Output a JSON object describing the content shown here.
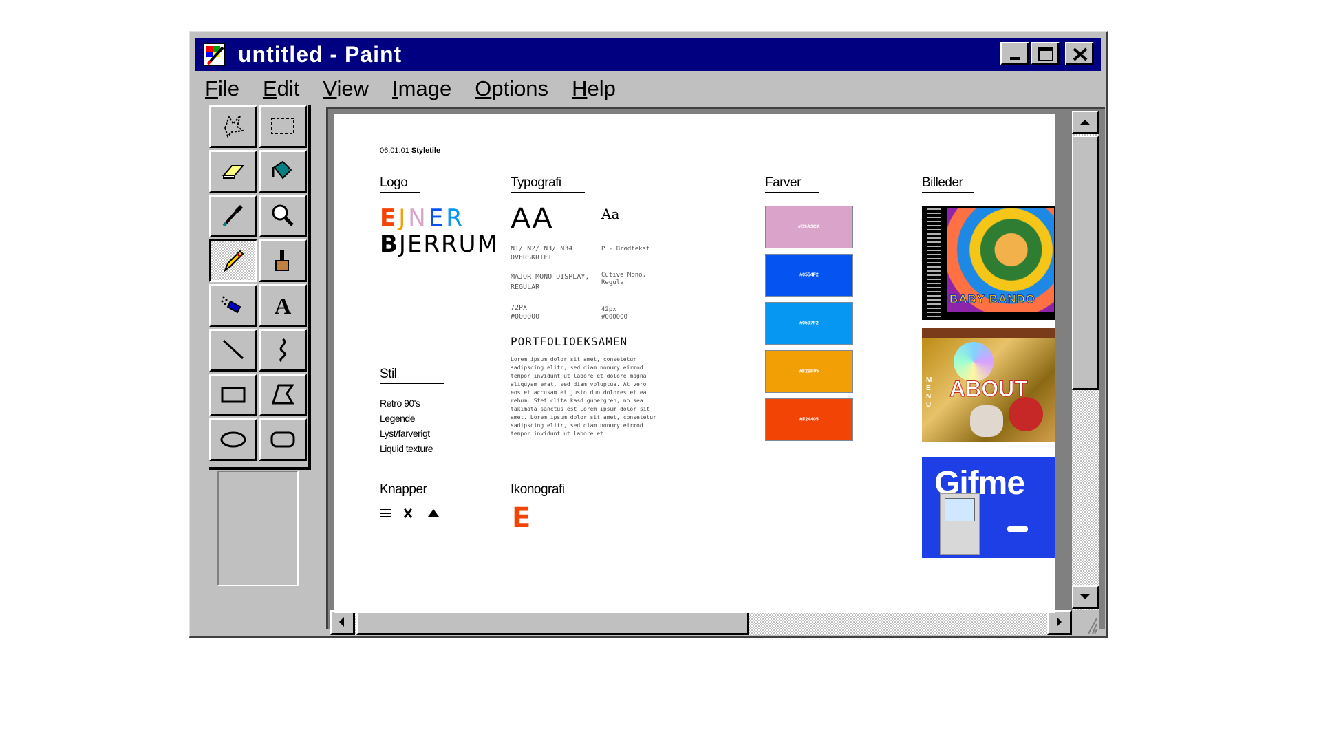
{
  "window": {
    "title": "untitled - Paint",
    "controls": {
      "minimize": "minimize",
      "maximize": "maximize",
      "close": "close"
    }
  },
  "menu": [
    {
      "key": "F",
      "rest": "ile"
    },
    {
      "key": "E",
      "rest": "dit"
    },
    {
      "key": "V",
      "rest": "iew"
    },
    {
      "key": "I",
      "rest": "mage"
    },
    {
      "key": "O",
      "rest": "ptions"
    },
    {
      "key": "H",
      "rest": "elp"
    }
  ],
  "tools": [
    "free-form-select-icon",
    "select-icon",
    "eraser-icon",
    "fill-bucket-icon",
    "color-picker-icon",
    "magnifier-icon",
    "pencil-icon",
    "brush-icon",
    "airbrush-icon",
    "text-icon",
    "line-icon",
    "curve-icon",
    "rectangle-icon",
    "polygon-icon",
    "ellipse-icon",
    "rounded-rectangle-icon"
  ],
  "active_tool": "pencil-icon",
  "doc": {
    "header_num": "06.01.01",
    "header_title": "Styletile",
    "logo": {
      "title": "Logo",
      "line1": [
        "E",
        "J",
        "N",
        "E",
        "R"
      ],
      "line1_colors": [
        "#F24405",
        "#F29F05",
        "#D9A3CA",
        "#0554F2",
        "#0597F2"
      ],
      "line2_first": "B",
      "line2_rest": "JERRUM"
    },
    "typografi": {
      "title": "Typografi",
      "big": "AA",
      "small": "Aa",
      "h_label_1": "N1/ N2/ N3/ N34",
      "h_label_2": "OVERSKRIFT",
      "p_label": "P - Brødtekst",
      "font1": "MAJOR MONO DISPLAY,",
      "font1b": "REGULAR",
      "font2": "Cutive Mono,",
      "font2b": "Regular",
      "size1": "72PX",
      "color1": "#000000",
      "size2": "42px",
      "color2": "#000000",
      "headline": "PORTFOLIOEKSAMEN",
      "body": "Lorem ipsum dolor sit amet, consetetur sadipscing elitr, sed diam nonumy eirmod tempor invidunt ut labore et dolore magna aliquyam erat, sed diam voluptua. At vero eos et accusam et justo duo dolores et ea rebum. Stet clita kasd gubergren, no sea takimata sanctus est Lorem ipsum dolor sit amet. Lorem ipsum dolor sit amet, consetetur sadipscing elitr, sed diam nonumy eirmod tempor invidunt ut labore et"
    },
    "farver": {
      "title": "Farver",
      "swatches": [
        {
          "hex": "#D9A3CA",
          "label": "#D9A3CA"
        },
        {
          "hex": "#0554F2",
          "label": "#0554F2"
        },
        {
          "hex": "#0597F2",
          "label": "#0597F2"
        },
        {
          "hex": "#F29F05",
          "label": "#F29F05"
        },
        {
          "hex": "#F24405",
          "label": "#F24405"
        }
      ]
    },
    "billeder": {
      "title": "Billeder",
      "img1_text": "BABY BANDO",
      "img2_text": "ABOUT",
      "img2_side": "MENU",
      "img3_text": "Gifme"
    },
    "stil": {
      "title": "Stil",
      "items": [
        "Retro 90's",
        "Legende",
        "Lyst/farverigt",
        "Liquid texture"
      ]
    },
    "knapper": {
      "title": "Knapper"
    },
    "ikonografi": {
      "title": "Ikonografi",
      "glyph": "E"
    }
  }
}
